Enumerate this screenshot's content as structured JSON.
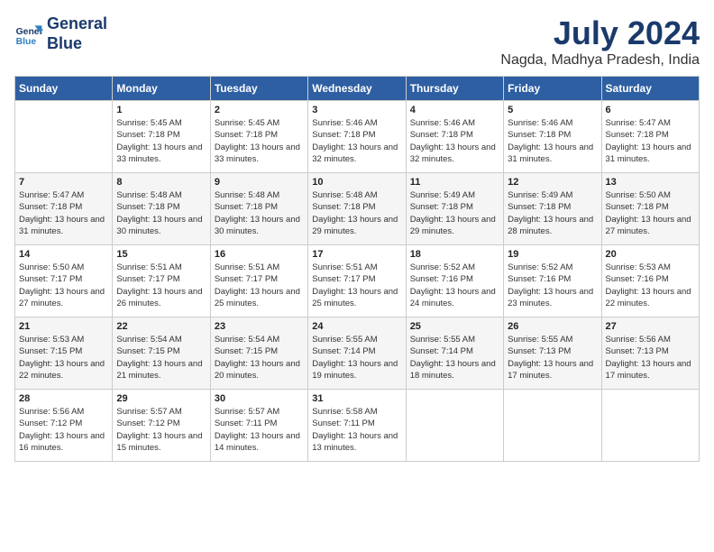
{
  "header": {
    "logo_line1": "General",
    "logo_line2": "Blue",
    "month_year": "July 2024",
    "location": "Nagda, Madhya Pradesh, India"
  },
  "weekdays": [
    "Sunday",
    "Monday",
    "Tuesday",
    "Wednesday",
    "Thursday",
    "Friday",
    "Saturday"
  ],
  "weeks": [
    [
      {
        "day": "",
        "info": ""
      },
      {
        "day": "1",
        "info": "Sunrise: 5:45 AM\nSunset: 7:18 PM\nDaylight: 13 hours\nand 33 minutes."
      },
      {
        "day": "2",
        "info": "Sunrise: 5:45 AM\nSunset: 7:18 PM\nDaylight: 13 hours\nand 33 minutes."
      },
      {
        "day": "3",
        "info": "Sunrise: 5:46 AM\nSunset: 7:18 PM\nDaylight: 13 hours\nand 32 minutes."
      },
      {
        "day": "4",
        "info": "Sunrise: 5:46 AM\nSunset: 7:18 PM\nDaylight: 13 hours\nand 32 minutes."
      },
      {
        "day": "5",
        "info": "Sunrise: 5:46 AM\nSunset: 7:18 PM\nDaylight: 13 hours\nand 31 minutes."
      },
      {
        "day": "6",
        "info": "Sunrise: 5:47 AM\nSunset: 7:18 PM\nDaylight: 13 hours\nand 31 minutes."
      }
    ],
    [
      {
        "day": "7",
        "info": "Sunrise: 5:47 AM\nSunset: 7:18 PM\nDaylight: 13 hours\nand 31 minutes."
      },
      {
        "day": "8",
        "info": "Sunrise: 5:48 AM\nSunset: 7:18 PM\nDaylight: 13 hours\nand 30 minutes."
      },
      {
        "day": "9",
        "info": "Sunrise: 5:48 AM\nSunset: 7:18 PM\nDaylight: 13 hours\nand 30 minutes."
      },
      {
        "day": "10",
        "info": "Sunrise: 5:48 AM\nSunset: 7:18 PM\nDaylight: 13 hours\nand 29 minutes."
      },
      {
        "day": "11",
        "info": "Sunrise: 5:49 AM\nSunset: 7:18 PM\nDaylight: 13 hours\nand 29 minutes."
      },
      {
        "day": "12",
        "info": "Sunrise: 5:49 AM\nSunset: 7:18 PM\nDaylight: 13 hours\nand 28 minutes."
      },
      {
        "day": "13",
        "info": "Sunrise: 5:50 AM\nSunset: 7:18 PM\nDaylight: 13 hours\nand 27 minutes."
      }
    ],
    [
      {
        "day": "14",
        "info": "Sunrise: 5:50 AM\nSunset: 7:17 PM\nDaylight: 13 hours\nand 27 minutes."
      },
      {
        "day": "15",
        "info": "Sunrise: 5:51 AM\nSunset: 7:17 PM\nDaylight: 13 hours\nand 26 minutes."
      },
      {
        "day": "16",
        "info": "Sunrise: 5:51 AM\nSunset: 7:17 PM\nDaylight: 13 hours\nand 25 minutes."
      },
      {
        "day": "17",
        "info": "Sunrise: 5:51 AM\nSunset: 7:17 PM\nDaylight: 13 hours\nand 25 minutes."
      },
      {
        "day": "18",
        "info": "Sunrise: 5:52 AM\nSunset: 7:16 PM\nDaylight: 13 hours\nand 24 minutes."
      },
      {
        "day": "19",
        "info": "Sunrise: 5:52 AM\nSunset: 7:16 PM\nDaylight: 13 hours\nand 23 minutes."
      },
      {
        "day": "20",
        "info": "Sunrise: 5:53 AM\nSunset: 7:16 PM\nDaylight: 13 hours\nand 22 minutes."
      }
    ],
    [
      {
        "day": "21",
        "info": "Sunrise: 5:53 AM\nSunset: 7:15 PM\nDaylight: 13 hours\nand 22 minutes."
      },
      {
        "day": "22",
        "info": "Sunrise: 5:54 AM\nSunset: 7:15 PM\nDaylight: 13 hours\nand 21 minutes."
      },
      {
        "day": "23",
        "info": "Sunrise: 5:54 AM\nSunset: 7:15 PM\nDaylight: 13 hours\nand 20 minutes."
      },
      {
        "day": "24",
        "info": "Sunrise: 5:55 AM\nSunset: 7:14 PM\nDaylight: 13 hours\nand 19 minutes."
      },
      {
        "day": "25",
        "info": "Sunrise: 5:55 AM\nSunset: 7:14 PM\nDaylight: 13 hours\nand 18 minutes."
      },
      {
        "day": "26",
        "info": "Sunrise: 5:55 AM\nSunset: 7:13 PM\nDaylight: 13 hours\nand 17 minutes."
      },
      {
        "day": "27",
        "info": "Sunrise: 5:56 AM\nSunset: 7:13 PM\nDaylight: 13 hours\nand 17 minutes."
      }
    ],
    [
      {
        "day": "28",
        "info": "Sunrise: 5:56 AM\nSunset: 7:12 PM\nDaylight: 13 hours\nand 16 minutes."
      },
      {
        "day": "29",
        "info": "Sunrise: 5:57 AM\nSunset: 7:12 PM\nDaylight: 13 hours\nand 15 minutes."
      },
      {
        "day": "30",
        "info": "Sunrise: 5:57 AM\nSunset: 7:11 PM\nDaylight: 13 hours\nand 14 minutes."
      },
      {
        "day": "31",
        "info": "Sunrise: 5:58 AM\nSunset: 7:11 PM\nDaylight: 13 hours\nand 13 minutes."
      },
      {
        "day": "",
        "info": ""
      },
      {
        "day": "",
        "info": ""
      },
      {
        "day": "",
        "info": ""
      }
    ]
  ]
}
